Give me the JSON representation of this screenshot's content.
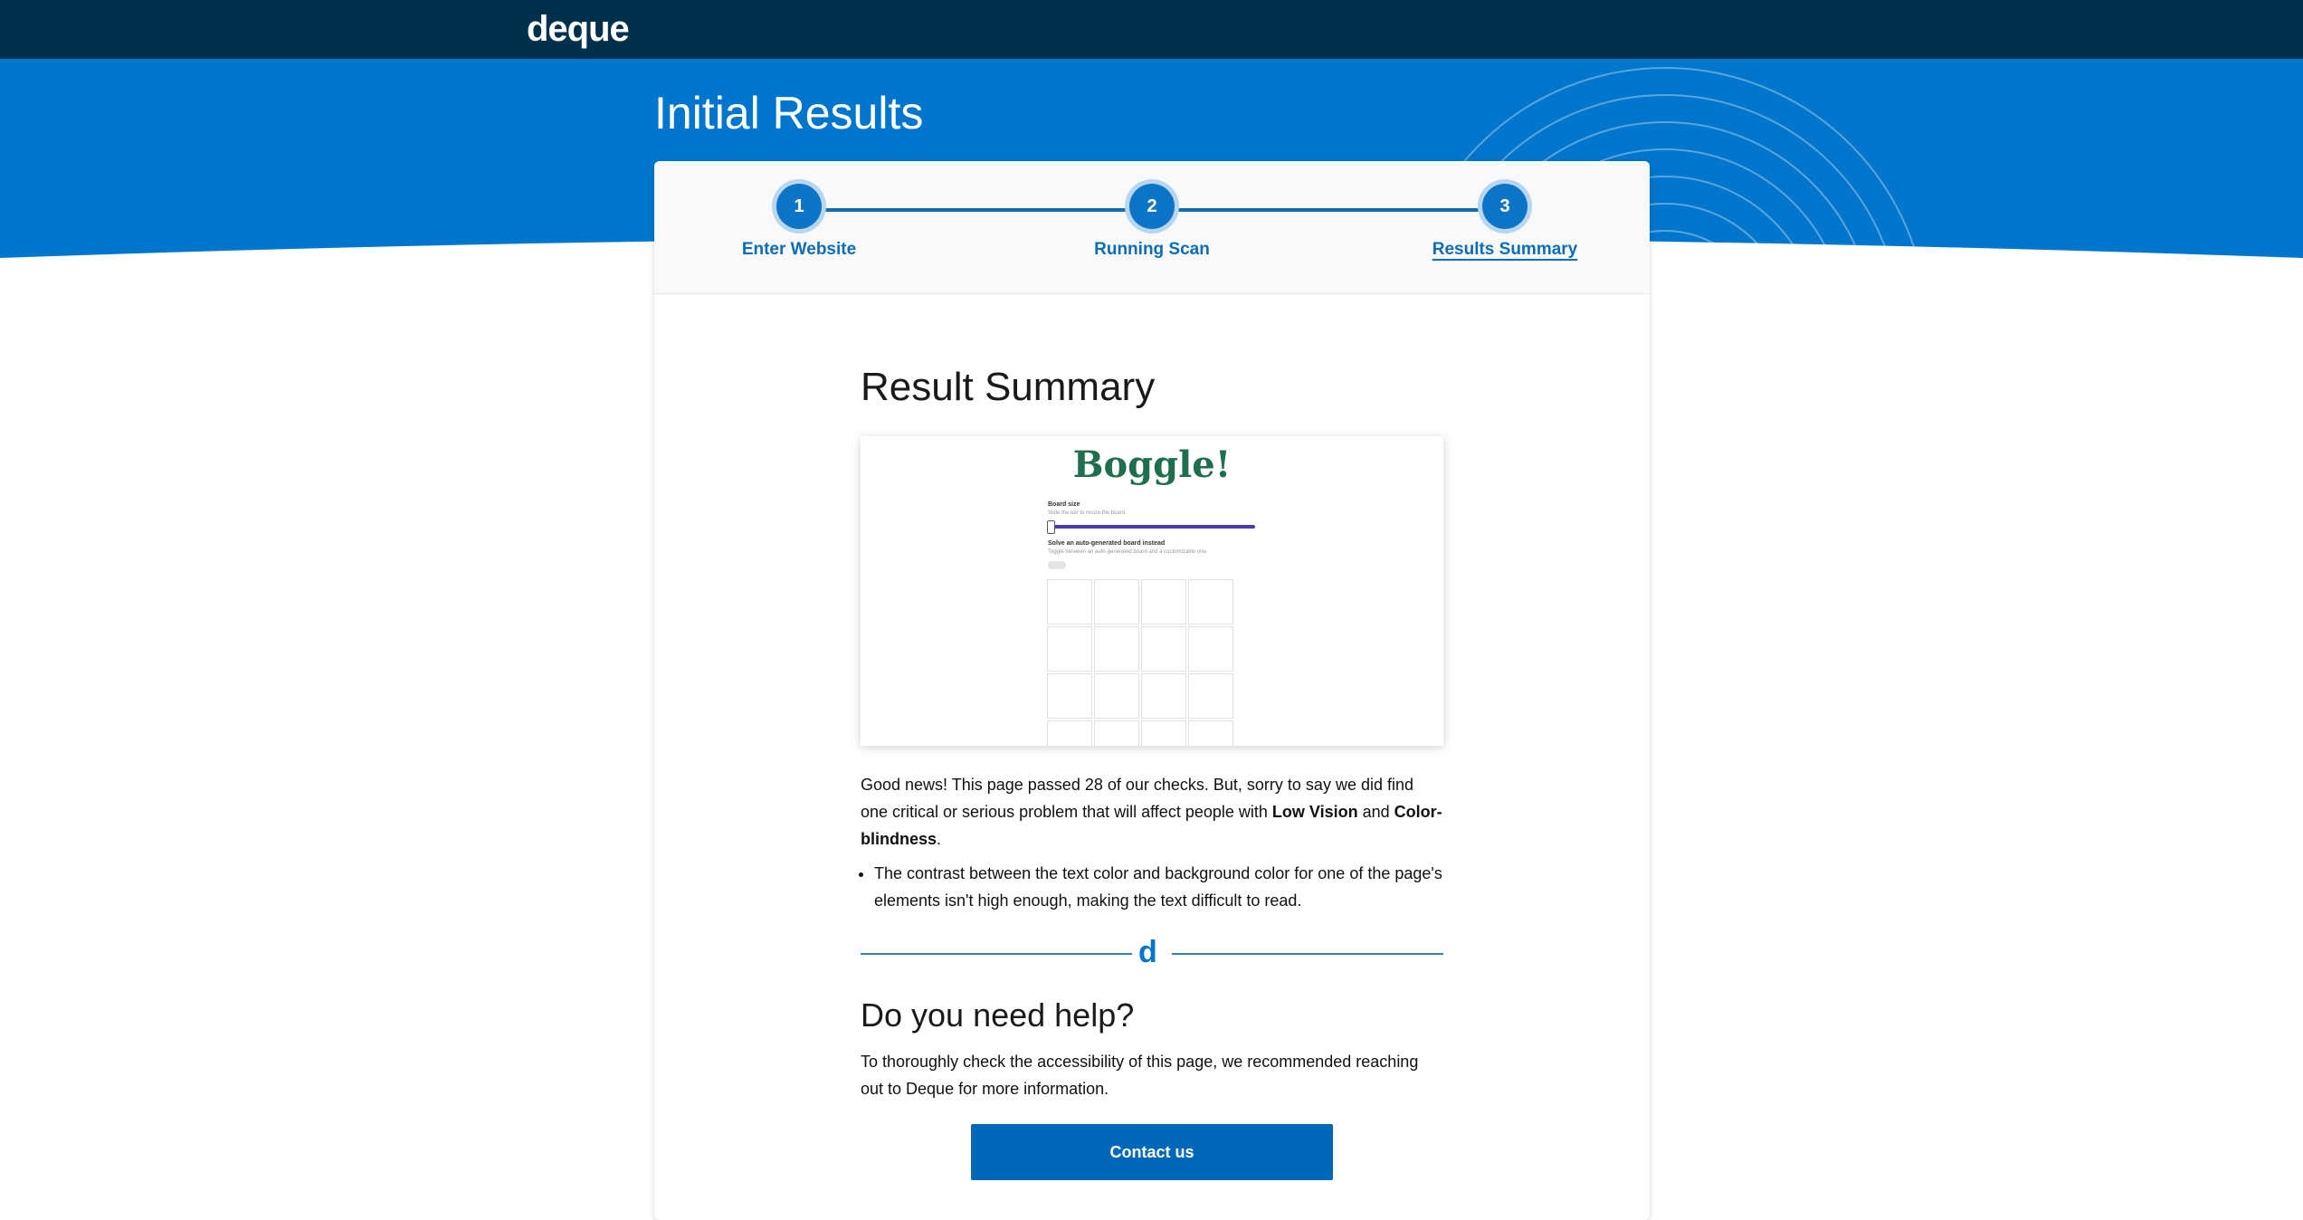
{
  "brand": {
    "logo_text": "deque"
  },
  "hero": {
    "title": "Initial Results"
  },
  "stepper": {
    "steps": [
      {
        "number": "1",
        "label": "Enter Website"
      },
      {
        "number": "2",
        "label": "Running Scan"
      },
      {
        "number": "3",
        "label": "Results Summary"
      }
    ],
    "active_step": 3
  },
  "summary": {
    "heading": "Result Summary",
    "screenshot": {
      "title": "Boggle!",
      "board_size_label": "Board size",
      "board_size_hint": "Slide the bar to resize the board.",
      "auto_board_label": "Solve an auto-generated board instead",
      "auto_board_hint": "Toggle between an auto-generated board and a customizable one."
    },
    "intro_1": "Good news! This page passed 28 of our checks. But, sorry to say we did find one critical or serious problem that will affect people with ",
    "impact_1": "Low Vision",
    "intro_and": " and ",
    "impact_2": "Color-blindness",
    "intro_end": ".",
    "issues": [
      "The contrast between the text color and background color for one of the page's elements isn't high enough, making the text difficult to read."
    ]
  },
  "divider": {
    "mark": "d"
  },
  "help": {
    "heading": "Do you need help?",
    "body": "To thoroughly check the accessibility of this page, we recommended reaching out to Deque for more information.",
    "button_label": "Contact us"
  },
  "colors": {
    "topbar": "#00304c",
    "hero": "#0176cc",
    "accent": "#0b6db8",
    "button": "#0167b8"
  }
}
